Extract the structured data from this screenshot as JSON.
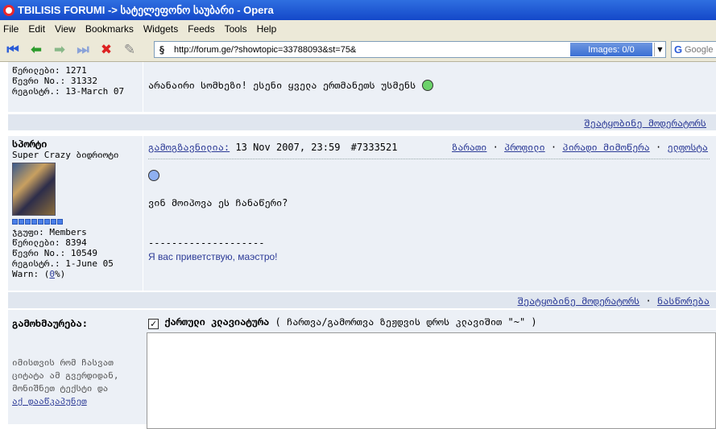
{
  "window": {
    "title": "TBILISIS FORUMI -> სატელეფონო საუბარი - Opera"
  },
  "menu": [
    "File",
    "Edit",
    "View",
    "Bookmarks",
    "Widgets",
    "Feeds",
    "Tools",
    "Help"
  ],
  "toolbar": {
    "url": "http://forum.ge/?showtopic=33788093&st=75&",
    "images_label": "Images:  0/0",
    "search_placeholder": "Google"
  },
  "prev_post": {
    "posts_label": "წერილები: 1271",
    "number_label": "წევრი No.: 31332",
    "registered_label": "რეგისტრ.: 13-March 07",
    "message": "არანაირი სომხეზი! ესენი ყველა ერთმანეთს უსმენს",
    "report_link": "შეატყობინე მოდერატორს"
  },
  "post": {
    "author": "სპორტი",
    "title": "Super Crazy ბიდრიოტი",
    "group_label": "ჯგუფი: Members",
    "posts_label": "წერილები: 8394",
    "number_label": "წევრი No.: 10549",
    "registered_label": "რეგისტრ.: 1-June 05",
    "warn_prefix": "Warn: (",
    "warn_value": "0",
    "warn_suffix": "%)",
    "posted_label": "გამოგზავნილია:",
    "date": "13 Nov 2007, 23:59",
    "post_id": "#7333521",
    "action_1": "ზარათი",
    "action_2": "პროფილი",
    "action_3": "პირადი მიმოწერა",
    "action_4": "ელფოსტა",
    "message": "ვინ მოიპოვა ეს ჩანაწერი?",
    "signature_line": "--------------------",
    "signature": "Я вас приветствую, маэстро!",
    "report_link": "შეატყობინე მოდერატორს",
    "quote_link": "ნასწორება"
  },
  "reply": {
    "heading": "გამოხმაურება:",
    "keyboard_label": "ქართული კლავიატურა",
    "keyboard_hint": "( ჩართვა/გამორთვა ზეჟდვის დროს კლავიშით \"~\" )",
    "help_text_1": "იმისთვის რომ ჩასვათ",
    "help_text_2": "ციტატა ამ გვერდიდან,",
    "help_text_3": "მონიშნეთ ტექსტი და",
    "help_link": "აქ დააწკაპუნეთ"
  }
}
